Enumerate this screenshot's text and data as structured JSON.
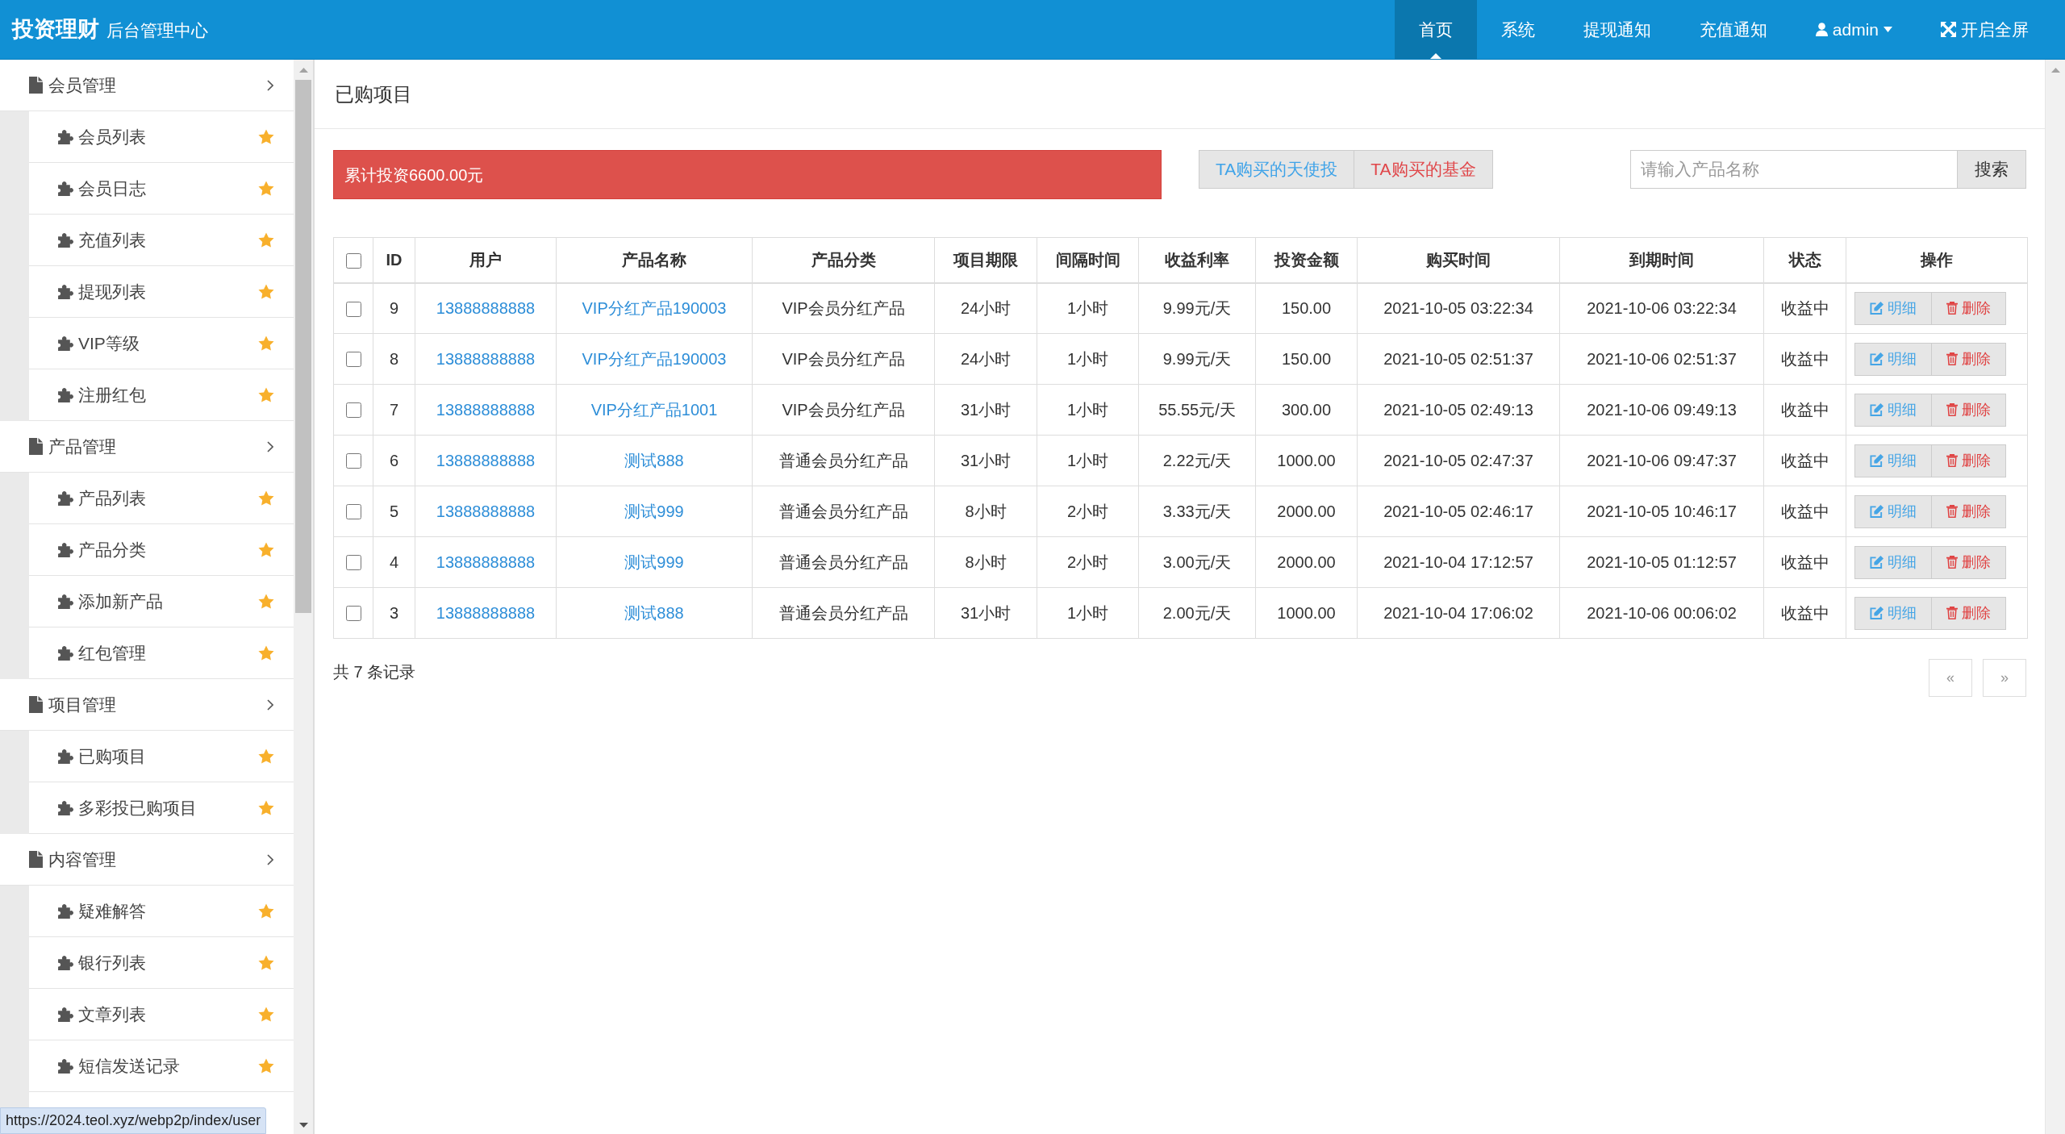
{
  "header": {
    "logo": "投资理财",
    "subtitle": "后台管理中心",
    "nav": [
      {
        "label": "首页",
        "kind": "link",
        "selected": true
      },
      {
        "label": "系统",
        "kind": "link",
        "selected": false
      },
      {
        "label": "提现通知",
        "kind": "link",
        "selected": false
      },
      {
        "label": "充值通知",
        "kind": "link",
        "selected": false
      },
      {
        "label": "admin",
        "kind": "user_menu",
        "selected": false
      },
      {
        "label": "开启全屏",
        "kind": "fullscreen",
        "selected": false
      }
    ]
  },
  "sidebar": {
    "groups": [
      {
        "label": "会员管理",
        "children": [
          {
            "label": "会员列表"
          },
          {
            "label": "会员日志"
          },
          {
            "label": "充值列表"
          },
          {
            "label": "提现列表"
          },
          {
            "label": "VIP等级"
          },
          {
            "label": "注册红包"
          }
        ]
      },
      {
        "label": "产品管理",
        "children": [
          {
            "label": "产品列表"
          },
          {
            "label": "产品分类"
          },
          {
            "label": "添加新产品"
          },
          {
            "label": "红包管理"
          }
        ]
      },
      {
        "label": "项目管理",
        "children": [
          {
            "label": "已购项目"
          },
          {
            "label": "多彩投已购项目"
          }
        ]
      },
      {
        "label": "内容管理",
        "children": [
          {
            "label": "疑难解答"
          },
          {
            "label": "银行列表"
          },
          {
            "label": "文章列表"
          },
          {
            "label": "短信发送记录"
          }
        ]
      }
    ]
  },
  "page_title": "已购项目",
  "summary": "累计投资6600.00元",
  "filters": [
    {
      "label": "TA购买的天使投",
      "color": "#3fa3e8"
    },
    {
      "label": "TA购买的基金",
      "color": "#e0474a"
    }
  ],
  "search": {
    "placeholder": "请输入产品名称",
    "button": "搜索"
  },
  "table": {
    "select_all_checked": false,
    "columns": [
      {
        "label": "ID",
        "kind": "text"
      },
      {
        "label": "用户",
        "kind": "link"
      },
      {
        "label": "产品名称",
        "kind": "link"
      },
      {
        "label": "产品分类",
        "kind": "text"
      },
      {
        "label": "项目期限",
        "kind": "text"
      },
      {
        "label": "间隔时间",
        "kind": "text"
      },
      {
        "label": "收益利率",
        "kind": "text"
      },
      {
        "label": "投资金额",
        "kind": "text"
      },
      {
        "label": "购买时间",
        "kind": "text"
      },
      {
        "label": "到期时间",
        "kind": "text"
      },
      {
        "label": "状态",
        "kind": "text"
      },
      {
        "label": "操作",
        "kind": "actions"
      }
    ],
    "rows": [
      {
        "checked": false,
        "cells": [
          "9",
          "13888888888",
          "VIP分红产品190003",
          "VIP会员分红产品",
          "24小时",
          "1小时",
          "9.99元/天",
          "150.00",
          "2021-10-05 03:22:34",
          "2021-10-06 03:22:34",
          "收益中"
        ],
        "actions": [
          {
            "kind": "detail",
            "label": "明细"
          },
          {
            "kind": "delete",
            "label": "删除"
          }
        ]
      },
      {
        "checked": false,
        "cells": [
          "8",
          "13888888888",
          "VIP分红产品190003",
          "VIP会员分红产品",
          "24小时",
          "1小时",
          "9.99元/天",
          "150.00",
          "2021-10-05 02:51:37",
          "2021-10-06 02:51:37",
          "收益中"
        ],
        "actions": [
          {
            "kind": "detail",
            "label": "明细"
          },
          {
            "kind": "delete",
            "label": "删除"
          }
        ]
      },
      {
        "checked": false,
        "cells": [
          "7",
          "13888888888",
          "VIP分红产品1001",
          "VIP会员分红产品",
          "31小时",
          "1小时",
          "55.55元/天",
          "300.00",
          "2021-10-05 02:49:13",
          "2021-10-06 09:49:13",
          "收益中"
        ],
        "actions": [
          {
            "kind": "detail",
            "label": "明细"
          },
          {
            "kind": "delete",
            "label": "删除"
          }
        ]
      },
      {
        "checked": false,
        "cells": [
          "6",
          "13888888888",
          "测试888",
          "普通会员分红产品",
          "31小时",
          "1小时",
          "2.22元/天",
          "1000.00",
          "2021-10-05 02:47:37",
          "2021-10-06 09:47:37",
          "收益中"
        ],
        "actions": [
          {
            "kind": "detail",
            "label": "明细"
          },
          {
            "kind": "delete",
            "label": "删除"
          }
        ]
      },
      {
        "checked": false,
        "cells": [
          "5",
          "13888888888",
          "测试999",
          "普通会员分红产品",
          "8小时",
          "2小时",
          "3.33元/天",
          "2000.00",
          "2021-10-05 02:46:17",
          "2021-10-05 10:46:17",
          "收益中"
        ],
        "actions": [
          {
            "kind": "detail",
            "label": "明细"
          },
          {
            "kind": "delete",
            "label": "删除"
          }
        ]
      },
      {
        "checked": false,
        "cells": [
          "4",
          "13888888888",
          "测试999",
          "普通会员分红产品",
          "8小时",
          "2小时",
          "3.00元/天",
          "2000.00",
          "2021-10-04 17:12:57",
          "2021-10-05 01:12:57",
          "收益中"
        ],
        "actions": [
          {
            "kind": "detail",
            "label": "明细"
          },
          {
            "kind": "delete",
            "label": "删除"
          }
        ]
      },
      {
        "checked": false,
        "cells": [
          "3",
          "13888888888",
          "测试888",
          "普通会员分红产品",
          "31小时",
          "1小时",
          "2.00元/天",
          "1000.00",
          "2021-10-04 17:06:02",
          "2021-10-06 00:06:02",
          "收益中"
        ],
        "actions": [
          {
            "kind": "detail",
            "label": "明细"
          },
          {
            "kind": "delete",
            "label": "删除"
          }
        ]
      }
    ]
  },
  "footer": {
    "record_count": "共 7 条记录",
    "pagination": [
      "«",
      "»"
    ]
  },
  "status_bar": {
    "url": "https://2024.teol.xyz/webp2p/index/user"
  }
}
